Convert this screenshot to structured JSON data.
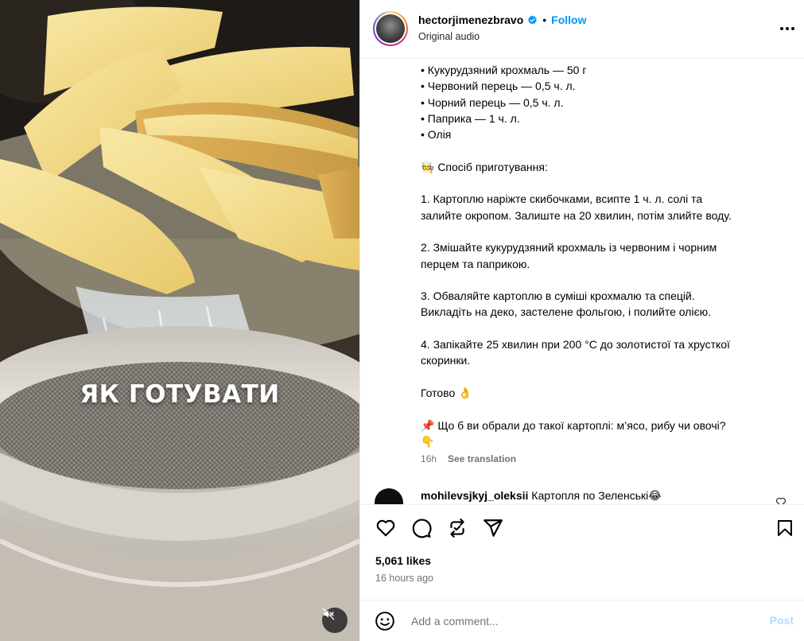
{
  "media": {
    "overlay_text": "ЯК ГОТУВАТИ",
    "mute_icon": "speaker-muted-icon"
  },
  "header": {
    "username": "hectorjimenezbravo",
    "verified": true,
    "separator": "•",
    "follow_label": "Follow",
    "audio_label": "Original audio",
    "more_icon": "more-horizontal-icon"
  },
  "caption": {
    "ingredients": [
      "• Кукурудзяний крохмаль — 50 г",
      "• Червоний перець — 0,5 ч. л.",
      "• Чорний перець — 0,5 ч. л.",
      "• Паприка — 1 ч. л.",
      "• Олія"
    ],
    "method_title": "🧑‍🍳 Спосіб приготування:",
    "steps": [
      [
        "1. Картоплю наріжте скибочками, всипте 1 ч. л. солі та",
        "залийте окропом. Залиште на 20 хвилин, потім злийте воду."
      ],
      [
        "2. Змішайте кукурудзяний крохмаль із червоним і чорним",
        "перцем та паприкою."
      ],
      [
        "3. Обваляйте картоплю в суміші крохмалю та спецій.",
        "Викладіть на деко, застелене фольгою, і полийте олією."
      ],
      [
        "4. Запікайте 25 хвилин при 200 °C до золотистої та хрусткої",
        "скоринки."
      ]
    ],
    "done_line": "Готово 👌",
    "question_line1": "📌 Що б ви обрали до такої картоплі: м’ясо, рибу чи овочі?",
    "question_line2": "👇",
    "age": "16h",
    "see_translation": "See translation"
  },
  "comment": {
    "username": "mohilevsjkyj_oleksii",
    "text": "Картопля по Зеленські😂"
  },
  "actions": {
    "icons": [
      "heart-icon",
      "comment-icon",
      "share-icon",
      "send-icon",
      "bookmark-icon"
    ]
  },
  "stats": {
    "likes": "5,061 likes",
    "time": "16 hours ago"
  },
  "add_comment": {
    "placeholder": "Add a comment...",
    "post_label": "Post"
  },
  "colors": {
    "accent": "#0095f6",
    "post_disabled": "#b3dbff",
    "secondary_text": "#737373",
    "divider": "#efefef"
  }
}
